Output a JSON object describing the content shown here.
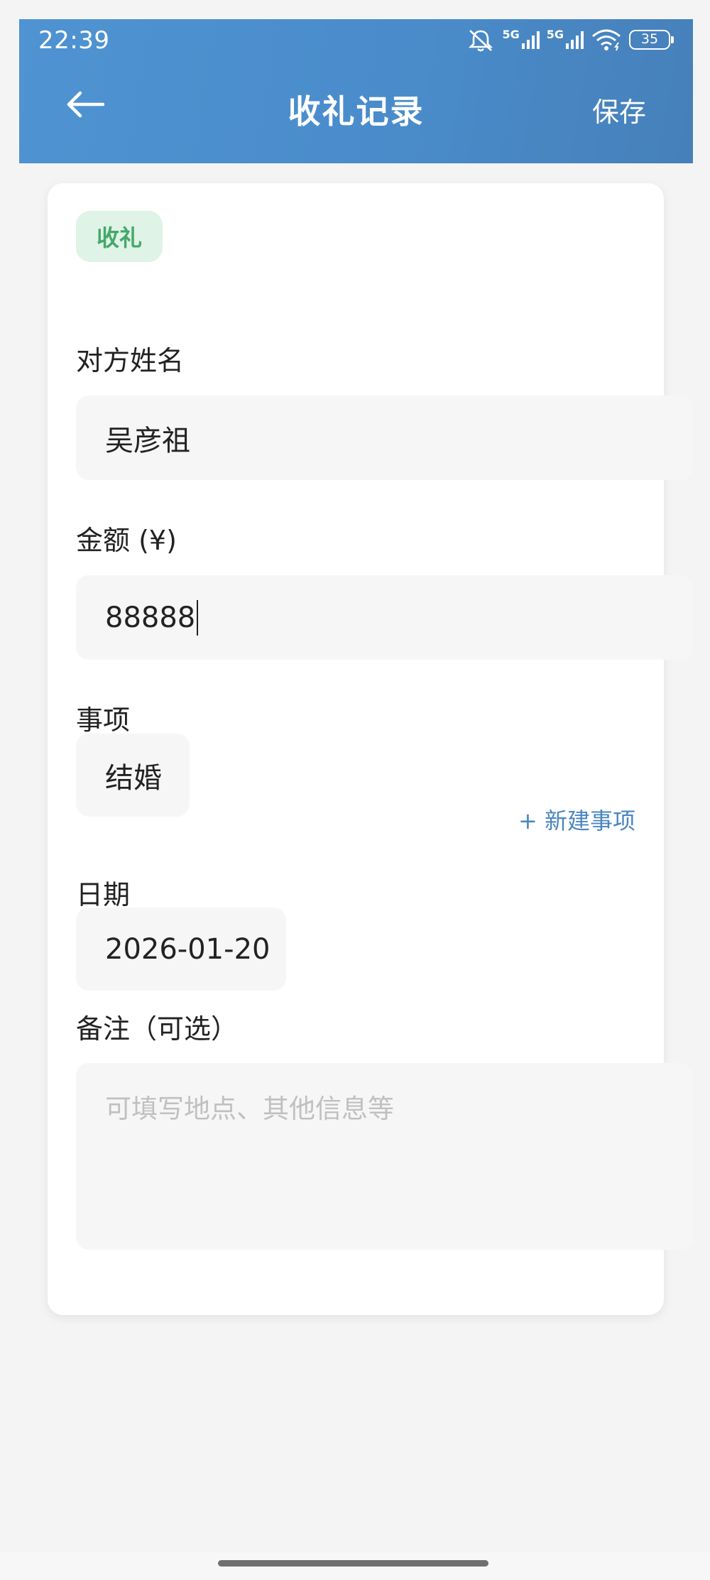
{
  "status_bar": {
    "time": "22:39",
    "network_1": "5G",
    "network_2": "5G",
    "battery": "35",
    "icons": [
      "bell-muted-icon",
      "signal-5g-icon",
      "signal-5g-icon",
      "wifi-icon",
      "battery-icon"
    ]
  },
  "header": {
    "title": "收礼记录",
    "save_label": "保存",
    "back_icon": "arrow-left-icon"
  },
  "form": {
    "type_badge": "收礼",
    "name_label": "对方姓名",
    "name_value": "吴彦祖",
    "amount_label": "金额 (¥)",
    "amount_value": "88888",
    "event_label": "事项",
    "event_value": "结婚",
    "new_event_link": "+ 新建事项",
    "date_label": "日期",
    "date_value": "2026-01-20",
    "note_label": "备注（可选）",
    "note_placeholder": "可填写地点、其他信息等"
  },
  "colors": {
    "header": "#4a8ccb",
    "badge_bg": "#dff3e6",
    "badge_text": "#45a869",
    "link": "#4a86c0"
  }
}
